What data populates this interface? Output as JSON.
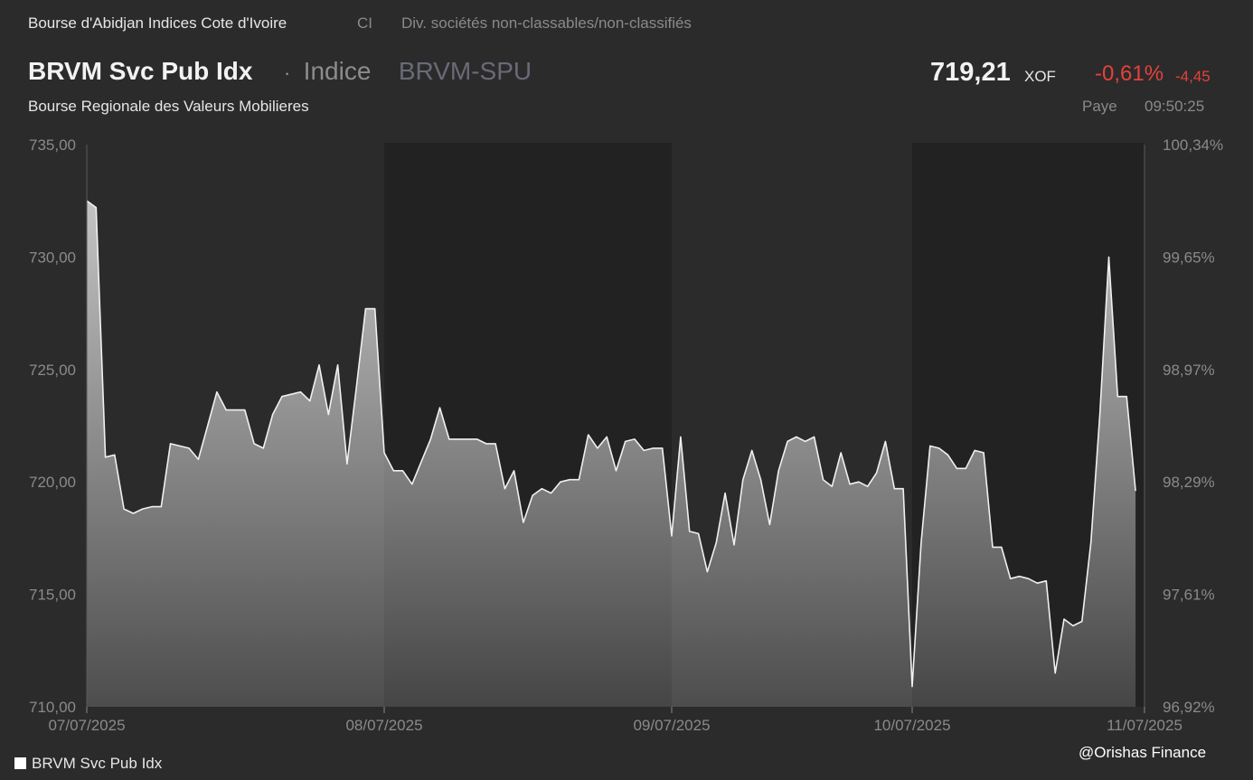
{
  "header": {
    "exchange": "Bourse d'Abidjan Indices Cote d'Ivoire",
    "country": "CI",
    "sector": "Div. sociétés non-classables/non-classifiés",
    "name": "BRVM Svc Pub Idx",
    "separator": "·",
    "type": "Indice",
    "ticker": "BRVM-SPU",
    "subtitle": "Bourse Regionale des Valeurs Mobilieres",
    "price": "719,21",
    "currency": "XOF",
    "change_pct": "-0,61%",
    "change_abs": "-4,45",
    "paye_label": "Paye",
    "time": "09:50:25"
  },
  "colors": {
    "background": "#2b2b2b",
    "shaded_band": "#222222",
    "line": "#f0f0f0",
    "negative": "#e5413b"
  },
  "legend": {
    "label": "BRVM Svc Pub Idx"
  },
  "watermark": "@Orishas Finance",
  "chart_data": {
    "type": "area",
    "ylim": [
      710,
      735
    ],
    "y_ticks": [
      "735,00",
      "730,00",
      "725,00",
      "720,00",
      "715,00",
      "710,00"
    ],
    "y2_ticks": [
      "100,34%",
      "99,65%",
      "98,97%",
      "98,29%",
      "97,61%",
      "96,92%"
    ],
    "x_ticks": [
      "07/07/2025",
      "08/07/2025",
      "09/07/2025",
      "10/07/2025",
      "11/07/2025"
    ],
    "shaded_days": [
      "08/07/2025",
      "10/07/2025"
    ],
    "grid": false,
    "legend_position": "bottom-left",
    "series": [
      {
        "name": "BRVM Svc Pub Idx",
        "days": [
          [
            732.5,
            732.2,
            721.1,
            721.2,
            718.8,
            718.6,
            718.8,
            718.9,
            718.9,
            721.7,
            721.6,
            721.5,
            721.0,
            722.5,
            724.0,
            723.2,
            723.2,
            723.2,
            721.7,
            721.5,
            723.0,
            723.8,
            723.9,
            724.0,
            723.6,
            725.2,
            723.0,
            725.2,
            720.8,
            724.2,
            727.7,
            727.7
          ],
          [
            721.3,
            720.5,
            720.5,
            719.9,
            720.9,
            721.9,
            723.3,
            721.9,
            721.9,
            721.9,
            721.9,
            721.7,
            721.7,
            719.7,
            720.5,
            718.2,
            719.4,
            719.7,
            719.5,
            720.0,
            720.1,
            720.1,
            722.1,
            721.5,
            722.0,
            720.5,
            721.8,
            721.9,
            721.4,
            721.5,
            721.5
          ],
          [
            717.6,
            722.0,
            717.8,
            717.7,
            716.0,
            717.3,
            719.5,
            717.2,
            720.1,
            721.4,
            720.1,
            718.1,
            720.5,
            721.8,
            722.0,
            721.8,
            722.0,
            720.1,
            719.8,
            721.3,
            719.9,
            720.0,
            719.8,
            720.4,
            721.8,
            719.7,
            719.7
          ],
          [
            710.9,
            717.3,
            721.6,
            721.5,
            721.2,
            720.6,
            720.6,
            721.4,
            721.3,
            717.1,
            717.1,
            715.7,
            715.8,
            715.7,
            715.5,
            715.6,
            711.5,
            713.9,
            713.6,
            713.8,
            717.3,
            723.0,
            730.0,
            723.8,
            723.8,
            719.6
          ]
        ]
      }
    ]
  }
}
